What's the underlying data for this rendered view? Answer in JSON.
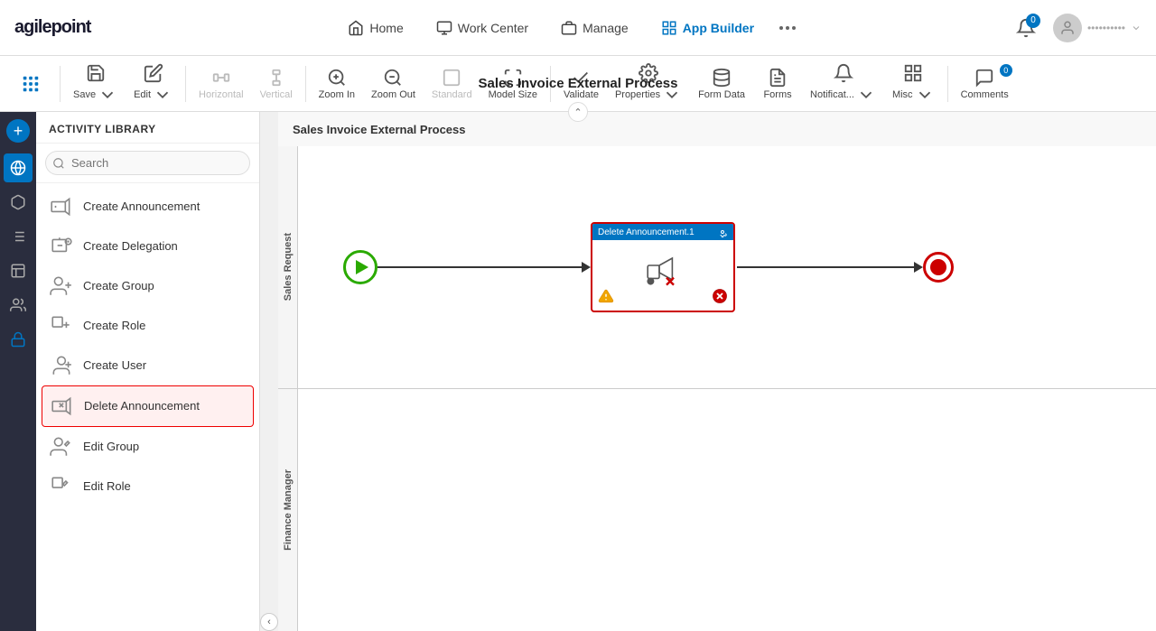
{
  "app": {
    "title": "AgilePoint"
  },
  "topnav": {
    "home_label": "Home",
    "workcenter_label": "Work Center",
    "manage_label": "Manage",
    "appbuilder_label": "App Builder",
    "notification_count": "0",
    "user_placeholder": "••••••••••"
  },
  "toolbar": {
    "process_title": "Sales Invoice External Process",
    "save_label": "Save",
    "edit_label": "Edit",
    "horizontal_label": "Horizontal",
    "vertical_label": "Vertical",
    "zoom_in_label": "Zoom In",
    "zoom_out_label": "Zoom Out",
    "standard_label": "Standard",
    "model_size_label": "Model Size",
    "validate_label": "Validate",
    "properties_label": "Properties",
    "form_data_label": "Form Data",
    "forms_label": "Forms",
    "notifications_label": "Notificat...",
    "misc_label": "Misc",
    "comments_label": "Comments",
    "comments_count": "0"
  },
  "activity_library": {
    "header": "ACTIVITY LIBRARY",
    "search_placeholder": "Search",
    "items": [
      {
        "id": "create-announcement",
        "label": "Create Announcement",
        "icon": "megaphone"
      },
      {
        "id": "create-delegation",
        "label": "Create Delegation",
        "icon": "chat-add"
      },
      {
        "id": "create-group",
        "label": "Create Group",
        "icon": "group-add"
      },
      {
        "id": "create-role",
        "label": "Create Role",
        "icon": "role-add"
      },
      {
        "id": "create-user",
        "label": "Create User",
        "icon": "user-add"
      },
      {
        "id": "delete-announcement",
        "label": "Delete Announcement",
        "icon": "megaphone-delete",
        "selected": true
      },
      {
        "id": "edit-group",
        "label": "Edit Group",
        "icon": "group-edit"
      },
      {
        "id": "edit-role",
        "label": "Edit Role",
        "icon": "role-edit"
      }
    ]
  },
  "canvas": {
    "process_label": "Sales Invoice External Process",
    "lane1_label": "Sales Request",
    "lane2_label": "Finance Manager",
    "node_label": "Delete Announcement.1"
  }
}
